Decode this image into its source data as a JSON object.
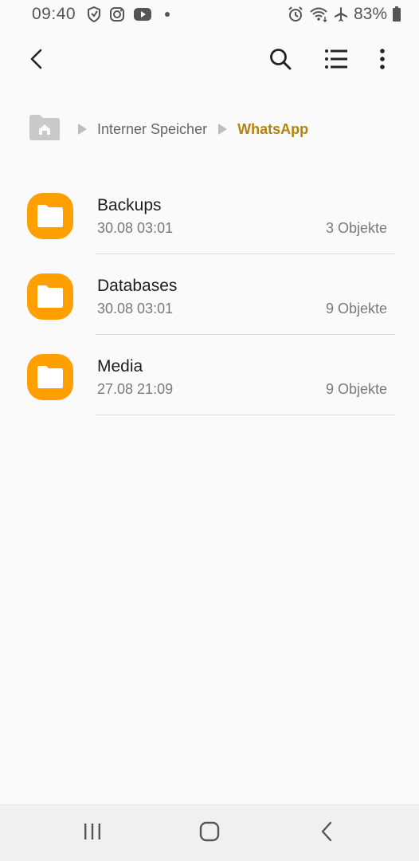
{
  "status_bar": {
    "time": "09:40",
    "battery_percent": "83%",
    "icons": [
      "shield-icon",
      "instagram-icon",
      "youtube-icon",
      "notification-dot",
      "alarm-icon",
      "wifi-icon",
      "airplane-mode-icon",
      "battery-icon"
    ]
  },
  "app_bar": {
    "icons": [
      "back-arrow-icon",
      "search-icon",
      "list-view-icon",
      "more-vert-icon"
    ]
  },
  "breadcrumb": {
    "home_icon": "home-folder-icon",
    "items": [
      "Interner Speicher"
    ],
    "current": "WhatsApp"
  },
  "files": [
    {
      "name": "Backups",
      "date": "30.08 03:01",
      "count": "3 Objekte"
    },
    {
      "name": "Databases",
      "date": "30.08 03:01",
      "count": "9 Objekte"
    },
    {
      "name": "Media",
      "date": "27.08 21:09",
      "count": "9 Objekte"
    }
  ],
  "colors": {
    "folder": "#ffa000",
    "breadcrumb_current": "#b5820b",
    "background": "#fafafa"
  },
  "nav_bar": {
    "icons": [
      "recent-apps-icon",
      "home-icon",
      "back-icon"
    ]
  }
}
